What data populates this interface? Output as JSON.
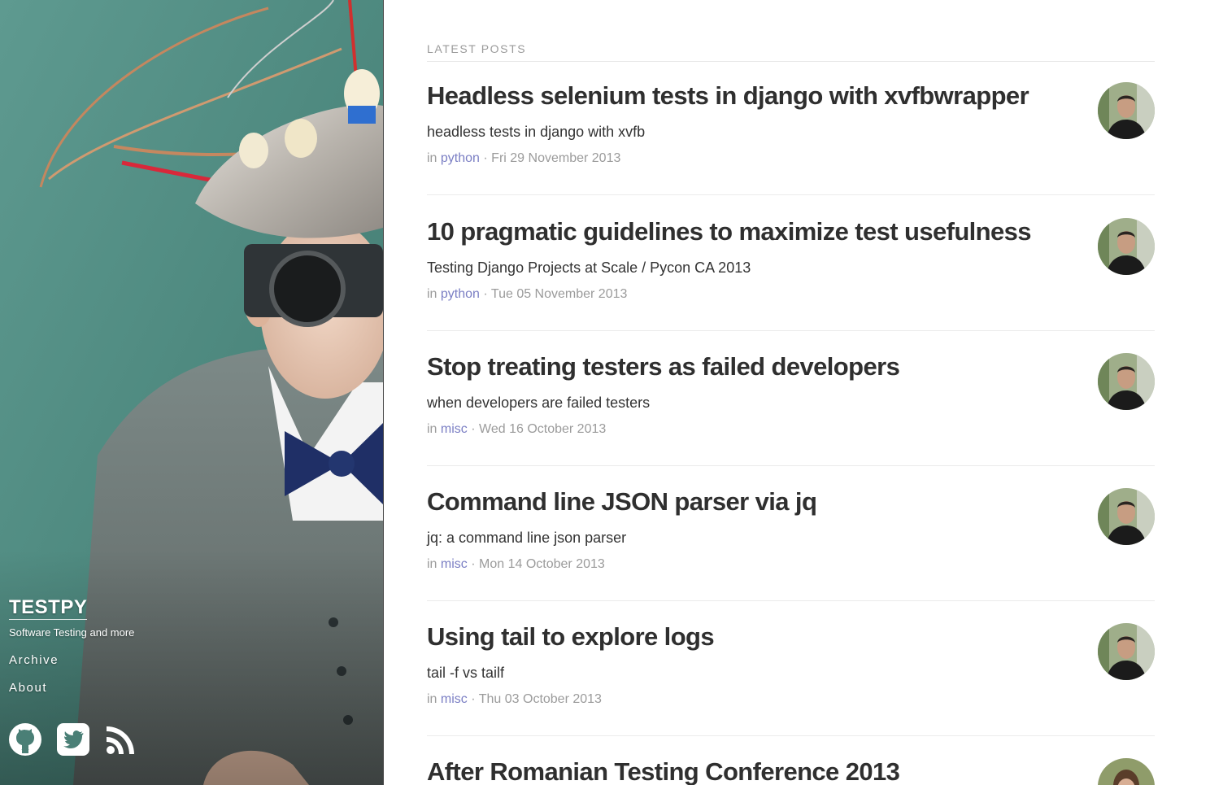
{
  "site": {
    "title": "TESTPY",
    "tagline": "Software Testing and more"
  },
  "nav": {
    "archive": "Archive",
    "about": "About"
  },
  "social": {
    "github_icon": "github-icon",
    "twitter_icon": "twitter-icon",
    "rss_icon": "rss-icon"
  },
  "main": {
    "section_label": "LATEST POSTS",
    "posts": [
      {
        "title": "Headless selenium tests in django with xvfbwrapper",
        "summary": "headless tests in django with xvfb",
        "prefix": "in",
        "category": "python",
        "date": "· Fri 29 November 2013"
      },
      {
        "title": "10 pragmatic guidelines to maximize test usefulness",
        "summary": "Testing Django Projects at Scale / Pycon CA 2013",
        "prefix": "in",
        "category": "python",
        "date": "· Tue 05 November 2013"
      },
      {
        "title": "Stop treating testers as failed developers",
        "summary": "when developers are failed testers",
        "prefix": "in",
        "category": "misc",
        "date": "· Wed 16 October 2013"
      },
      {
        "title": "Command line JSON parser via jq",
        "summary": "jq: a command line json parser",
        "prefix": "in",
        "category": "misc",
        "date": "· Mon 14 October 2013"
      },
      {
        "title": "Using tail to explore logs",
        "summary": "tail -f vs tailf",
        "prefix": "in",
        "category": "misc",
        "date": "· Thu 03 October 2013"
      },
      {
        "title": "After Romanian Testing Conference 2013",
        "summary": "",
        "prefix": "",
        "category": "",
        "date": ""
      }
    ]
  },
  "colors": {
    "category_link": "#7b7fc4",
    "meta_text": "#9b9b9b",
    "title_text": "#2f2f2f"
  }
}
